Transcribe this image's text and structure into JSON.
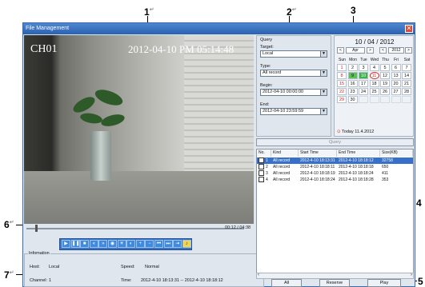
{
  "annotations": [
    "1",
    "2",
    "3",
    "4",
    "5",
    "6",
    "7"
  ],
  "window": {
    "title": "File Management"
  },
  "video": {
    "channel": "CH01",
    "timestamp": "2012-04-10 PM 05:14:48",
    "position": "00:12 / 04:38",
    "progress": 0.04
  },
  "toolbar": {
    "buttons": [
      "play-icon",
      "pause-icon",
      "stop-icon",
      "slow-icon",
      "fast-icon",
      "snapshot-icon",
      "brightness-icon",
      "contrast-icon",
      "zoom-in-icon",
      "zoom-out-icon",
      "prev-icon",
      "next-icon",
      "step-icon",
      "volume-icon"
    ]
  },
  "info": {
    "title": "Infomation",
    "host_label": "Host:",
    "host": "Local",
    "speed_label": "Speed:",
    "speed": "Normal",
    "channel_label": "Channel:",
    "channel": "1",
    "time_label": "Time:",
    "time": "2012-4-10 18:13:31 -- 2012-4-10 18:18:12"
  },
  "query": {
    "title": "Query",
    "target_label": "Target:",
    "target": "Local",
    "type_label": "Type:",
    "type": "All record",
    "begin_label": "Begin:",
    "begin": "2012-04-10 00:00:00",
    "end_label": "End:",
    "end": "2012-04-10 23:59:59",
    "button": "Query"
  },
  "calendar": {
    "title": "10 / 04 / 2012",
    "month": "Apr",
    "year": "2012",
    "prev_month": "<",
    "next_month": ">",
    "prev_year": "<",
    "next_year": ">",
    "weekdays": [
      "Sun",
      "Mon",
      "Tue",
      "Wed",
      "Thu",
      "Fri",
      "Sat"
    ],
    "days": [
      [
        "1",
        "2",
        "3",
        "4",
        "5",
        "6",
        "7"
      ],
      [
        "8",
        "9",
        "10",
        "11",
        "12",
        "13",
        "14"
      ],
      [
        "15",
        "16",
        "17",
        "18",
        "19",
        "20",
        "21"
      ],
      [
        "22",
        "23",
        "24",
        "25",
        "26",
        "27",
        "28"
      ],
      [
        "29",
        "30",
        "",
        "",
        "",
        "",
        ""
      ]
    ],
    "selected_day": "10",
    "today": "Today 11.4.2012"
  },
  "results": {
    "columns": [
      "No.",
      "Kind",
      "Start Time",
      "End Time",
      "Size(KB)"
    ],
    "rows": [
      [
        "1",
        "All record",
        "2012-4-10 18:13:31",
        "2012-4-10 18:18:12",
        "32758"
      ],
      [
        "2",
        "All record",
        "2012-4-10 18:18:11",
        "2012-4-10 18:18:18",
        "650"
      ],
      [
        "3",
        "All record",
        "2012-4-10 18:18:19",
        "2012-4-10 18:18:24",
        "411"
      ],
      [
        "4",
        "All record",
        "2012-4-10 18:18:24",
        "2012-4-10 18:18:28",
        "353"
      ]
    ]
  },
  "buttons": {
    "all": "All",
    "reserve": "Reserve",
    "play": "Play"
  },
  "colors": {
    "titlebar": "#2a62b2",
    "selection": "#3670c8",
    "today_marker": "#d12a2a",
    "selected_day": "#3db34a"
  }
}
